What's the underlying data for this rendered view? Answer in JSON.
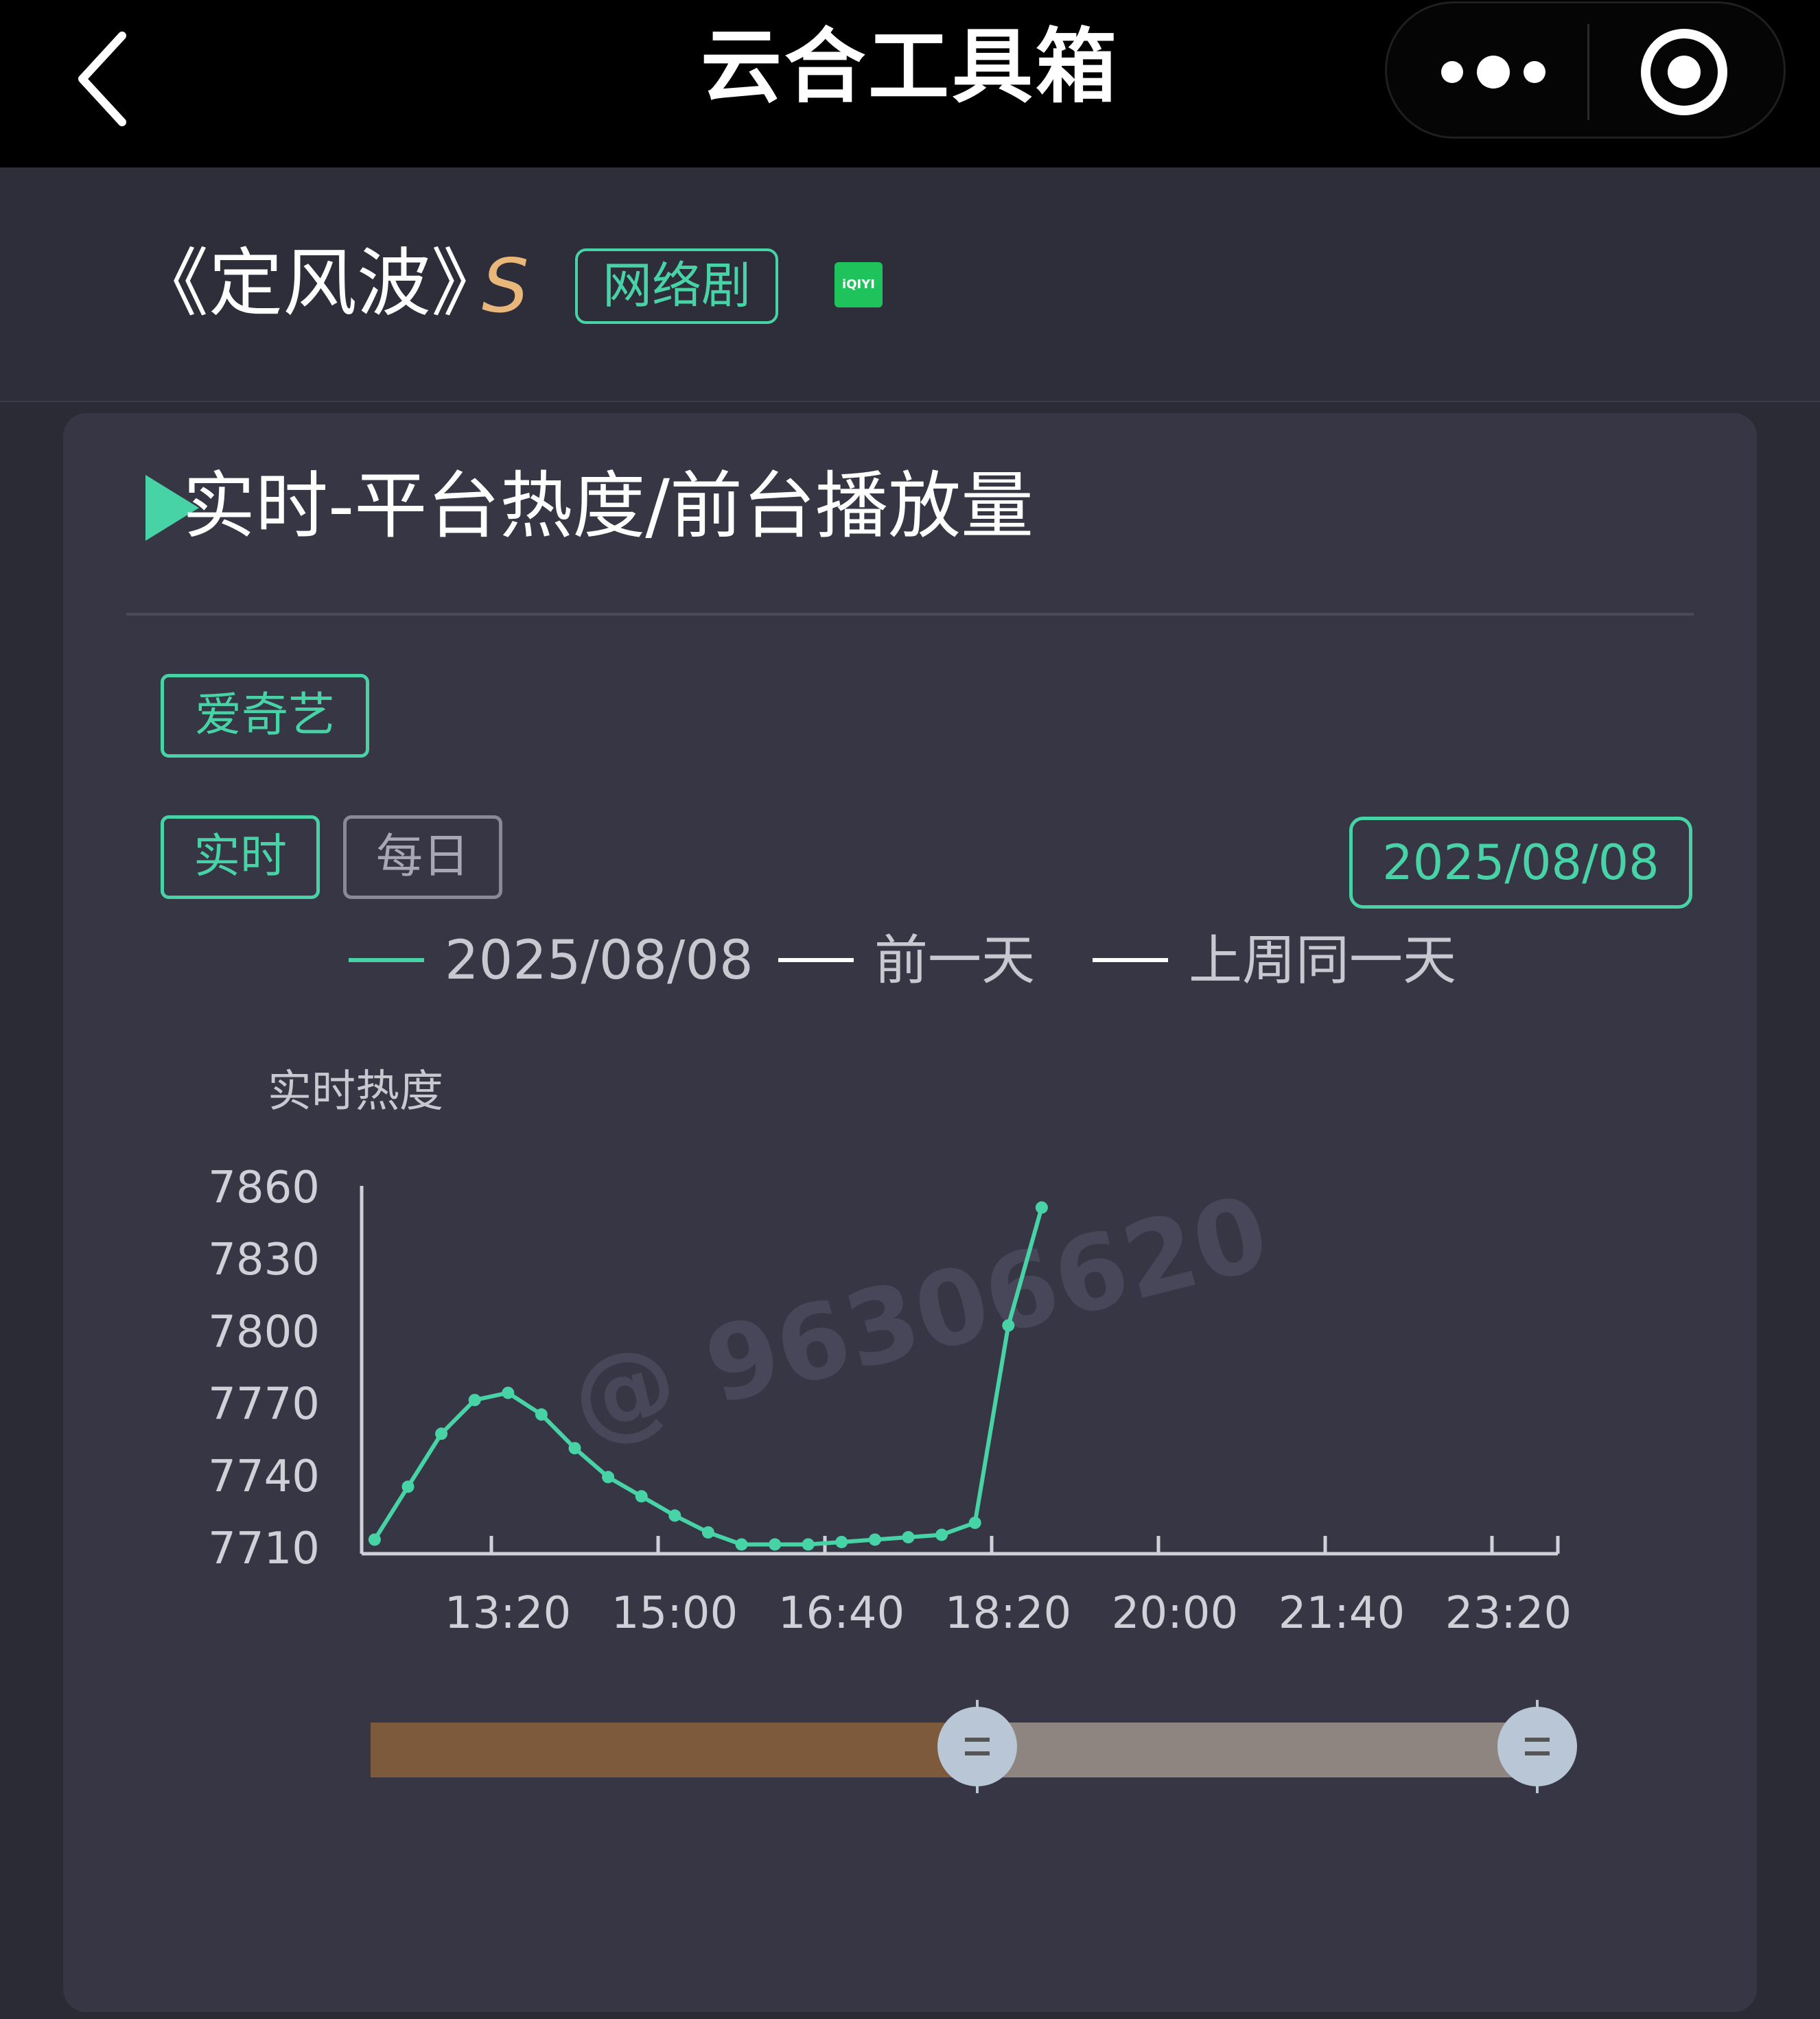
{
  "app": {
    "title": "云合工具箱",
    "back_icon": "chevron-left-icon",
    "more_icon": "more-dots-icon",
    "close_icon": "target-circle-icon"
  },
  "show": {
    "title": "《定风波》",
    "grade": "S",
    "type_badge": "网络剧",
    "platform_logo_text": "iQIYI"
  },
  "section": {
    "title": "实时-平台热度/前台播放量",
    "platform_tab": "爱奇艺",
    "mode_tabs": [
      {
        "label": "实时",
        "active": true
      },
      {
        "label": "每日",
        "active": false
      }
    ],
    "date": "2025/08/08"
  },
  "legend": [
    {
      "label": "2025/08/08",
      "color": "#48d3a7"
    },
    {
      "label": "前一天",
      "color": "#ffffff"
    },
    {
      "label": "上周同一天",
      "color": "#ffffff"
    }
  ],
  "watermark": "@ 96306620",
  "colors": {
    "accent": "#48d3a7",
    "grade": "#e9b77a",
    "slider_fill": "#7d5a3c",
    "slider_track": "#8f8580",
    "slider_handle": "#b8c6d6"
  },
  "chart_data": {
    "type": "line",
    "ylabel": "实时热度",
    "y_ticks": [
      "7860",
      "7830",
      "7800",
      "7770",
      "7740",
      "7710"
    ],
    "ylim": [
      7710,
      7860
    ],
    "x_ticks": [
      "13:20",
      "15:00",
      "16:40",
      "18:20",
      "20:00",
      "21:40",
      "23:20"
    ],
    "series": [
      {
        "name": "2025/08/08",
        "color": "#48d3a7",
        "x": [
          "12:10",
          "12:30",
          "12:50",
          "13:10",
          "13:30",
          "13:50",
          "14:10",
          "14:30",
          "14:50",
          "15:10",
          "15:30",
          "15:50",
          "16:10",
          "16:30",
          "16:50",
          "17:10",
          "17:30",
          "17:50",
          "18:10",
          "18:30",
          "18:50"
        ],
        "values": [
          7713,
          7735,
          7757,
          7771,
          7774,
          7765,
          7751,
          7739,
          7731,
          7723,
          7716,
          7711,
          7711,
          7711,
          7712,
          7713,
          7714,
          7715,
          7720,
          7802,
          7851
        ]
      }
    ]
  },
  "slider": {
    "start": 0,
    "left_handle": 0.52,
    "right_handle": 1.0
  }
}
